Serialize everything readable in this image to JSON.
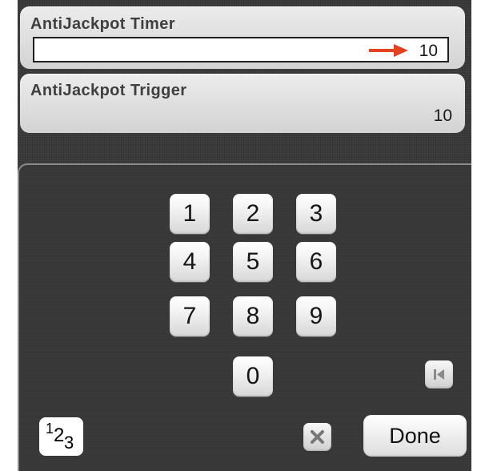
{
  "settings": [
    {
      "label": "AntiJackpot Timer",
      "value": "10"
    },
    {
      "label": "AntiJackpot Trigger",
      "value": "10"
    }
  ],
  "keypad": {
    "keys": [
      "1",
      "2",
      "3",
      "4",
      "5",
      "6",
      "7",
      "8",
      "9",
      "0"
    ],
    "numeric_toggle": {
      "sup": "1",
      "main": "2",
      "sub": "3"
    },
    "done_label": "Done",
    "icons": {
      "arrow": "right-arrow-icon",
      "skip_back": "skip-back-icon",
      "clear": "clear-x-icon"
    },
    "colors": {
      "accent_arrow": "#e3411f",
      "panel": "#373737"
    }
  }
}
